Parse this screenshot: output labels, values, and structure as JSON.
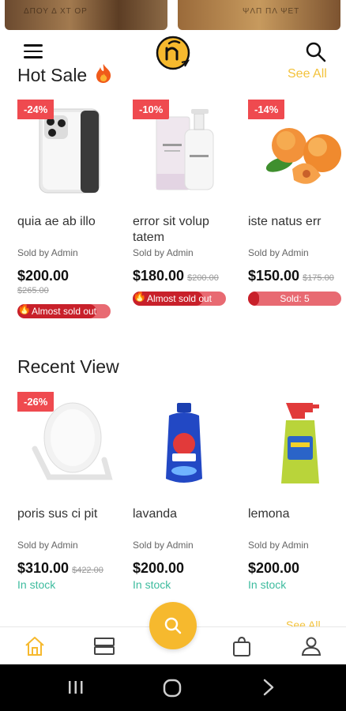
{
  "top_banners": [
    {
      "text": "ΔΠΟΥ Δ ΧΤ ΟΡ"
    },
    {
      "text": "ΨΛΠ ΠΛ ΨΕΤ"
    }
  ],
  "hot_sale": {
    "title": "Hot Sale",
    "title_icon": "fire-icon",
    "see_all": "See All",
    "items": [
      {
        "discount": "-24%",
        "name": "quia  ae ab illo",
        "sold_by": "Sold by Admin",
        "price": "$200.00",
        "old_price": "$265.00",
        "badge": "Almost sold out",
        "progress": 0.85
      },
      {
        "discount": "-10%",
        "name": "error sit volup tatem",
        "sold_by": "Sold by Admin",
        "price": "$180.00",
        "old_price": "$200.00",
        "badge": "Almost sold out",
        "progress": 0.75
      },
      {
        "discount": "-14%",
        "name": "iste natus err",
        "sold_by": "Sold by Admin",
        "price": "$150.00",
        "old_price": "$175.00",
        "badge": "Sold: 5",
        "progress": 0.12
      }
    ]
  },
  "recent_view": {
    "title": "Recent View",
    "see_all": "See All",
    "items": [
      {
        "discount": "-26%",
        "name": "poris sus ci pit",
        "sold_by": "Sold by Admin",
        "price": "$310.00",
        "old_price": "$422.00",
        "stock": "In stock"
      },
      {
        "name": "lavanda",
        "sold_by": "Sold by Admin",
        "price": "$200.00",
        "stock": "In stock"
      },
      {
        "name": "lemona",
        "sold_by": "Sold by Admin",
        "price": "$200.00",
        "stock": "In stock"
      }
    ]
  },
  "bottom_nav": [
    {
      "icon": "home-icon",
      "active": true
    },
    {
      "icon": "categories-icon",
      "active": false
    },
    {
      "icon": "search-icon",
      "active": false
    },
    {
      "icon": "bag-icon",
      "active": false
    },
    {
      "icon": "profile-icon",
      "active": false
    }
  ],
  "colors": {
    "accent": "#f6b92e",
    "discount": "#ef4a4f",
    "in_stock": "#3dbb9e",
    "see_all": "#f3c23b"
  }
}
